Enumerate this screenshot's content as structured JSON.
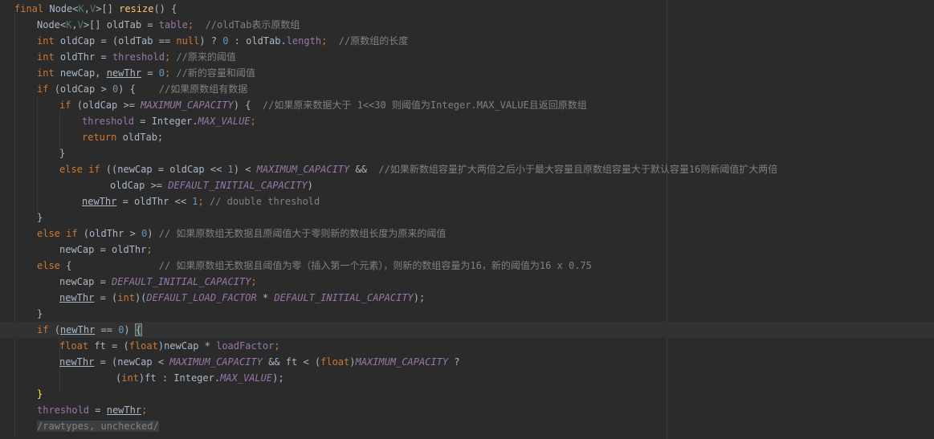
{
  "lines": [
    {
      "indent": 18,
      "tokens": [
        {
          "t": "final ",
          "c": "kw"
        },
        {
          "t": "Node<",
          "c": ""
        },
        {
          "t": "K",
          "c": "gen"
        },
        {
          "t": ",",
          "c": ""
        },
        {
          "t": "V",
          "c": "gen"
        },
        {
          "t": ">[] ",
          "c": ""
        },
        {
          "t": "resize",
          "c": "fn"
        },
        {
          "t": "() {",
          "c": ""
        }
      ]
    },
    {
      "indent": 46,
      "tokens": [
        {
          "t": "Node<",
          "c": ""
        },
        {
          "t": "K",
          "c": "gen"
        },
        {
          "t": ",",
          "c": ""
        },
        {
          "t": "V",
          "c": "gen"
        },
        {
          "t": ">[] oldTab = ",
          "c": ""
        },
        {
          "t": "table",
          "c": "fld"
        },
        {
          "t": ";  ",
          "c": "kw"
        },
        {
          "t": "//oldTab表示原数组",
          "c": "cmt"
        }
      ]
    },
    {
      "indent": 46,
      "tokens": [
        {
          "t": "int ",
          "c": "kw"
        },
        {
          "t": "oldCap = (oldTab == ",
          "c": ""
        },
        {
          "t": "null",
          "c": "kw"
        },
        {
          "t": ") ? ",
          "c": ""
        },
        {
          "t": "0",
          "c": "num"
        },
        {
          "t": " : oldTab.",
          "c": ""
        },
        {
          "t": "length",
          "c": "fld"
        },
        {
          "t": ";  ",
          "c": "kw"
        },
        {
          "t": "//原数组的长度",
          "c": "cmt"
        }
      ]
    },
    {
      "indent": 46,
      "tokens": [
        {
          "t": "int ",
          "c": "kw"
        },
        {
          "t": "oldThr = ",
          "c": ""
        },
        {
          "t": "threshold",
          "c": "fld"
        },
        {
          "t": "; ",
          "c": "kw"
        },
        {
          "t": "//原来的阈值",
          "c": "cmt"
        }
      ]
    },
    {
      "indent": 46,
      "tokens": [
        {
          "t": "int ",
          "c": "kw"
        },
        {
          "t": "newCap, ",
          "c": ""
        },
        {
          "t": "newThr",
          "c": "und"
        },
        {
          "t": " = ",
          "c": ""
        },
        {
          "t": "0",
          "c": "num"
        },
        {
          "t": "; ",
          "c": "kw"
        },
        {
          "t": "//新的容量和阈值",
          "c": "cmt"
        }
      ]
    },
    {
      "indent": 46,
      "tokens": [
        {
          "t": "if ",
          "c": "kw"
        },
        {
          "t": "(oldCap > ",
          "c": ""
        },
        {
          "t": "0",
          "c": "num"
        },
        {
          "t": ") {    ",
          "c": ""
        },
        {
          "t": "//如果原数组有数据",
          "c": "cmt"
        }
      ]
    },
    {
      "indent": 74,
      "tokens": [
        {
          "t": "if ",
          "c": "kw"
        },
        {
          "t": "(oldCap >= ",
          "c": ""
        },
        {
          "t": "MAXIMUM_CAPACITY",
          "c": "cst"
        },
        {
          "t": ") {  ",
          "c": ""
        },
        {
          "t": "//如果原来数据大于 1<<30 则阈值为Integer.MAX_VALUE且返回原数组",
          "c": "cmt"
        }
      ]
    },
    {
      "indent": 102,
      "tokens": [
        {
          "t": "threshold",
          "c": "fld"
        },
        {
          "t": " = Integer.",
          "c": ""
        },
        {
          "t": "MAX_VALUE",
          "c": "cst"
        },
        {
          "t": ";",
          "c": "kw"
        }
      ]
    },
    {
      "indent": 102,
      "tokens": [
        {
          "t": "return ",
          "c": "kw"
        },
        {
          "t": "oldTab;",
          "c": ""
        }
      ]
    },
    {
      "indent": 74,
      "tokens": [
        {
          "t": "}",
          "c": ""
        }
      ]
    },
    {
      "indent": 74,
      "tokens": [
        {
          "t": "else if ",
          "c": "kw"
        },
        {
          "t": "((newCap = oldCap << ",
          "c": ""
        },
        {
          "t": "1",
          "c": "num"
        },
        {
          "t": ") < ",
          "c": ""
        },
        {
          "t": "MAXIMUM_CAPACITY",
          "c": "cst"
        },
        {
          "t": " && ",
          "c": ""
        },
        {
          "t": " //如果新数组容量扩大两倍之后小于最大容量且原数组容量大于默认容量16则新阈值扩大两倍",
          "c": "cmt"
        }
      ]
    },
    {
      "indent": 137,
      "tokens": [
        {
          "t": "oldCap >= ",
          "c": ""
        },
        {
          "t": "DEFAULT_INITIAL_CAPACITY",
          "c": "cst"
        },
        {
          "t": ")",
          "c": ""
        }
      ]
    },
    {
      "indent": 102,
      "tokens": [
        {
          "t": "newThr",
          "c": "und"
        },
        {
          "t": " = oldThr << ",
          "c": ""
        },
        {
          "t": "1",
          "c": "num"
        },
        {
          "t": "; ",
          "c": "kw"
        },
        {
          "t": "// double threshold",
          "c": "cmt"
        }
      ]
    },
    {
      "indent": 46,
      "tokens": [
        {
          "t": "}",
          "c": ""
        }
      ]
    },
    {
      "indent": 46,
      "tokens": [
        {
          "t": "else if ",
          "c": "kw"
        },
        {
          "t": "(oldThr > ",
          "c": ""
        },
        {
          "t": "0",
          "c": "num"
        },
        {
          "t": ") ",
          "c": ""
        },
        {
          "t": "// 如果原数组无数据且原阈值大于零则新的数组长度为原来的阈值",
          "c": "cmt"
        }
      ]
    },
    {
      "indent": 74,
      "tokens": [
        {
          "t": "newCap = oldThr",
          "c": ""
        },
        {
          "t": ";",
          "c": "kw"
        }
      ]
    },
    {
      "indent": 46,
      "tokens": [
        {
          "t": "else ",
          "c": "kw"
        },
        {
          "t": "{               ",
          "c": ""
        },
        {
          "t": "// 如果原数组无数据且阈值为零（插入第一个元素），则新的数组容量为16，新的阈值为16 x 0.75",
          "c": "cmt"
        }
      ]
    },
    {
      "indent": 74,
      "tokens": [
        {
          "t": "newCap = ",
          "c": ""
        },
        {
          "t": "DEFAULT_INITIAL_CAPACITY",
          "c": "cst"
        },
        {
          "t": ";",
          "c": "kw"
        }
      ]
    },
    {
      "indent": 74,
      "tokens": [
        {
          "t": "newThr",
          "c": "und"
        },
        {
          "t": " = (",
          "c": ""
        },
        {
          "t": "int",
          "c": "kw"
        },
        {
          "t": ")(",
          "c": ""
        },
        {
          "t": "DEFAULT_LOAD_FACTOR",
          "c": "cst"
        },
        {
          "t": " * ",
          "c": ""
        },
        {
          "t": "DEFAULT_INITIAL_CAPACITY",
          "c": "cst"
        },
        {
          "t": ");",
          "c": ""
        }
      ]
    },
    {
      "indent": 46,
      "tokens": [
        {
          "t": "}",
          "c": ""
        }
      ]
    },
    {
      "indent": 46,
      "current": true,
      "tokens": [
        {
          "t": "if ",
          "c": "kw"
        },
        {
          "t": "(",
          "c": ""
        },
        {
          "t": "newThr",
          "c": "und"
        },
        {
          "t": " == ",
          "c": ""
        },
        {
          "t": "0",
          "c": "num"
        },
        {
          "t": ") ",
          "c": ""
        },
        {
          "t": "{",
          "c": "brace-match"
        },
        {
          "t": "",
          "c": "caret"
        }
      ]
    },
    {
      "indent": 74,
      "tokens": [
        {
          "t": "float ",
          "c": "kw"
        },
        {
          "t": "ft = (",
          "c": ""
        },
        {
          "t": "float",
          "c": "kw"
        },
        {
          "t": ")newCap * ",
          "c": ""
        },
        {
          "t": "loadFactor",
          "c": "fld"
        },
        {
          "t": ";",
          "c": "kw"
        }
      ]
    },
    {
      "indent": 74,
      "tokens": [
        {
          "t": "newThr",
          "c": "und"
        },
        {
          "t": " = (newCap < ",
          "c": ""
        },
        {
          "t": "MAXIMUM_CAPACITY",
          "c": "cst"
        },
        {
          "t": " && ft < (",
          "c": ""
        },
        {
          "t": "float",
          "c": "kw"
        },
        {
          "t": ")",
          "c": ""
        },
        {
          "t": "MAXIMUM_CAPACITY",
          "c": "cst"
        },
        {
          "t": " ?",
          "c": ""
        }
      ]
    },
    {
      "indent": 144,
      "tokens": [
        {
          "t": "(",
          "c": ""
        },
        {
          "t": "int",
          "c": "kw"
        },
        {
          "t": ")ft : Integer.",
          "c": ""
        },
        {
          "t": "MAX_VALUE",
          "c": "cst"
        },
        {
          "t": ");",
          "c": ""
        }
      ]
    },
    {
      "indent": 46,
      "tokens": [
        {
          "t": "}",
          "c": "brace-match yellow"
        }
      ]
    },
    {
      "indent": 46,
      "tokens": [
        {
          "t": "threshold",
          "c": "fld"
        },
        {
          "t": " = ",
          "c": ""
        },
        {
          "t": "newThr",
          "c": "und"
        },
        {
          "t": ";",
          "c": "kw"
        }
      ]
    },
    {
      "indent": 46,
      "tokens": [
        {
          "t": "/rawtypes, unchecked/",
          "c": "annot"
        }
      ]
    }
  ]
}
